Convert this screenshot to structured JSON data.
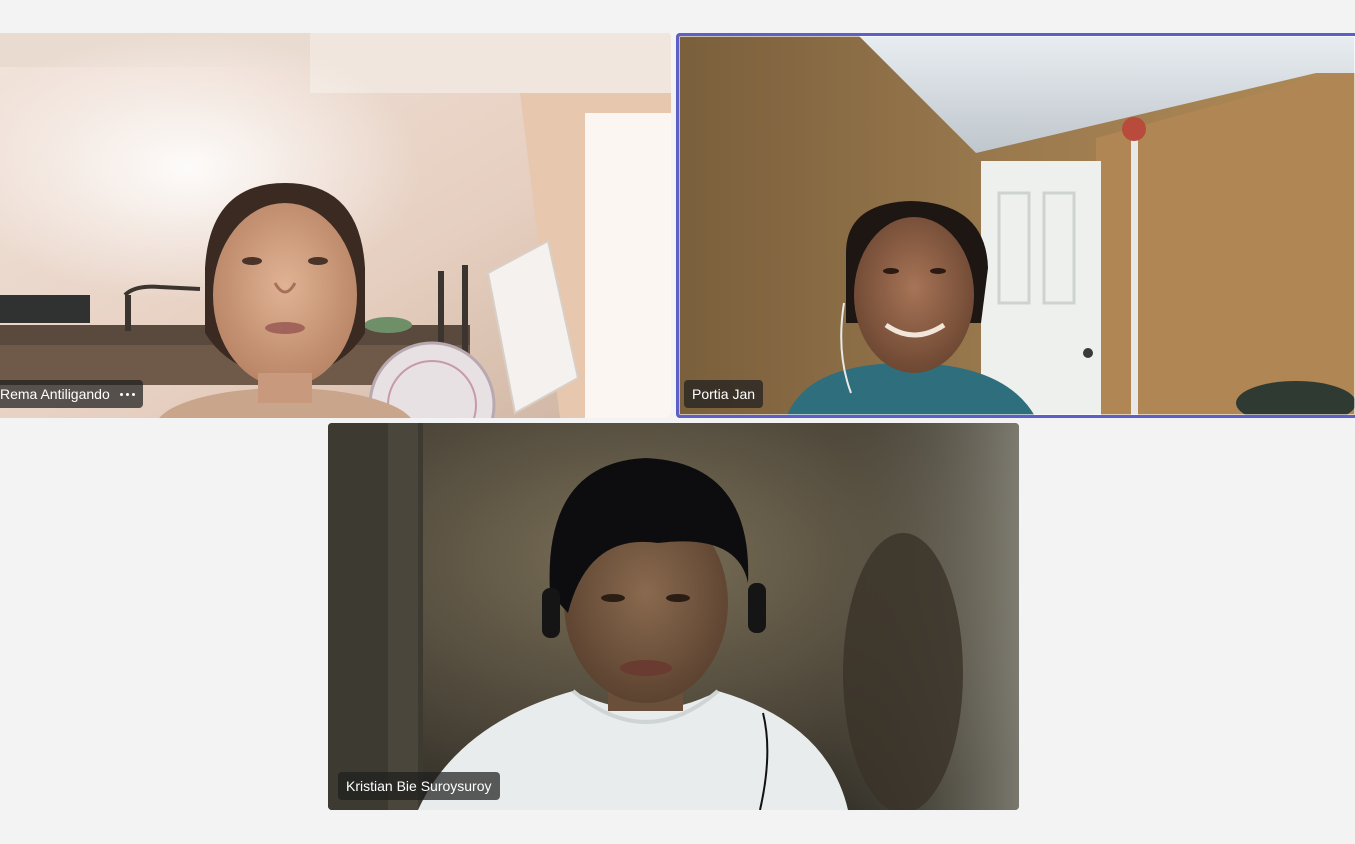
{
  "participants": [
    {
      "name": "Rema Antiligando",
      "has_menu": true
    },
    {
      "name": "Portia Jan",
      "active_speaker": true
    },
    {
      "name": "Kristian Bie Suroysuroy"
    }
  ],
  "colors": {
    "background": "#f3f3f3",
    "active_speaker_ring": "#5b5fc7",
    "name_tag_bg": "rgba(30,30,30,0.72)"
  },
  "icons": {
    "more_options": "more-horizontal-icon"
  }
}
